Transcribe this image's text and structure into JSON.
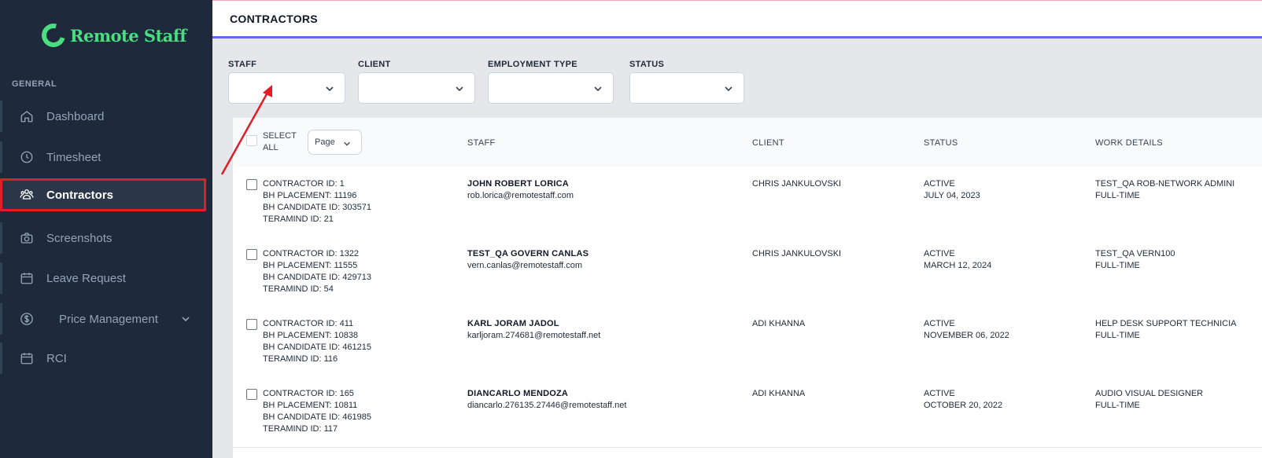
{
  "brand": {
    "name": "Remote Staff",
    "color": "#4ade80"
  },
  "sidebar": {
    "section_label": "GENERAL",
    "items": [
      {
        "label": "Dashboard",
        "icon": "home-icon"
      },
      {
        "label": "Timesheet",
        "icon": "clock-icon"
      },
      {
        "label": "Contractors",
        "icon": "users-icon",
        "active": true
      },
      {
        "label": "Screenshots",
        "icon": "camera-icon"
      },
      {
        "label": "Leave Request",
        "icon": "calendar-icon"
      },
      {
        "label": "Price Management",
        "icon": "dollar-icon",
        "has_submenu": true
      },
      {
        "label": "RCI",
        "icon": "calendar-icon"
      }
    ]
  },
  "header": {
    "title": "CONTRACTORS"
  },
  "filters": {
    "staff_label": "STAFF",
    "client_label": "CLIENT",
    "employment_type_label": "EMPLOYMENT TYPE",
    "status_label": "STATUS"
  },
  "table": {
    "select_all_label": "SELECT ALL",
    "page_select_value": "Page",
    "columns": {
      "staff": "STAFF",
      "client": "CLIENT",
      "status": "STATUS",
      "work_details": "WORK DETAILS"
    },
    "rows": [
      {
        "contractor_id": "CONTRACTOR ID: 1",
        "bh_placement": "BH PLACEMENT: 11196",
        "bh_candidate_id": "BH CANDIDATE ID: 303571",
        "teramind_id": "TERAMIND ID: 21",
        "staff_name": "JOHN ROBERT LORICA",
        "staff_email": "rob.lorica@remotestaff.com",
        "client": "CHRIS JANKULOVSKI",
        "status": "ACTIVE",
        "status_date": "JULY 04, 2023",
        "work_title": "TEST_QA ROB-NETWORK ADMINI",
        "work_type": "FULL-TIME"
      },
      {
        "contractor_id": "CONTRACTOR ID: 1322",
        "bh_placement": "BH PLACEMENT: 11555",
        "bh_candidate_id": "BH CANDIDATE ID: 429713",
        "teramind_id": "TERAMIND ID: 54",
        "staff_name": "TEST_QA GOVERN CANLAS",
        "staff_email": "vern.canlas@remotestaff.com",
        "client": "CHRIS JANKULOVSKI",
        "status": "ACTIVE",
        "status_date": "MARCH 12, 2024",
        "work_title": "TEST_QA VERN100",
        "work_type": "FULL-TIME"
      },
      {
        "contractor_id": "CONTRACTOR ID: 411",
        "bh_placement": "BH PLACEMENT: 10838",
        "bh_candidate_id": "BH CANDIDATE ID: 461215",
        "teramind_id": "TERAMIND ID: 116",
        "staff_name": "KARL JORAM JADOL",
        "staff_email": "karljoram.274681@remotestaff.net",
        "client": "ADI KHANNA",
        "status": "ACTIVE",
        "status_date": "NOVEMBER 06, 2022",
        "work_title": "HELP DESK SUPPORT TECHNICIA",
        "work_type": "FULL-TIME"
      },
      {
        "contractor_id": "CONTRACTOR ID: 165",
        "bh_placement": "BH PLACEMENT: 10811",
        "bh_candidate_id": "BH CANDIDATE ID: 461985",
        "teramind_id": "TERAMIND ID: 117",
        "staff_name": "DIANCARLO MENDOZA",
        "staff_email": "diancarlo.276135.27446@remotestaff.net",
        "client": "ADI KHANNA",
        "status": "ACTIVE",
        "status_date": "OCTOBER 20, 2022",
        "work_title": "AUDIO VISUAL DESIGNER",
        "work_type": "FULL-TIME"
      }
    ]
  },
  "annotation": {
    "highlight_color": "#e11d28"
  }
}
